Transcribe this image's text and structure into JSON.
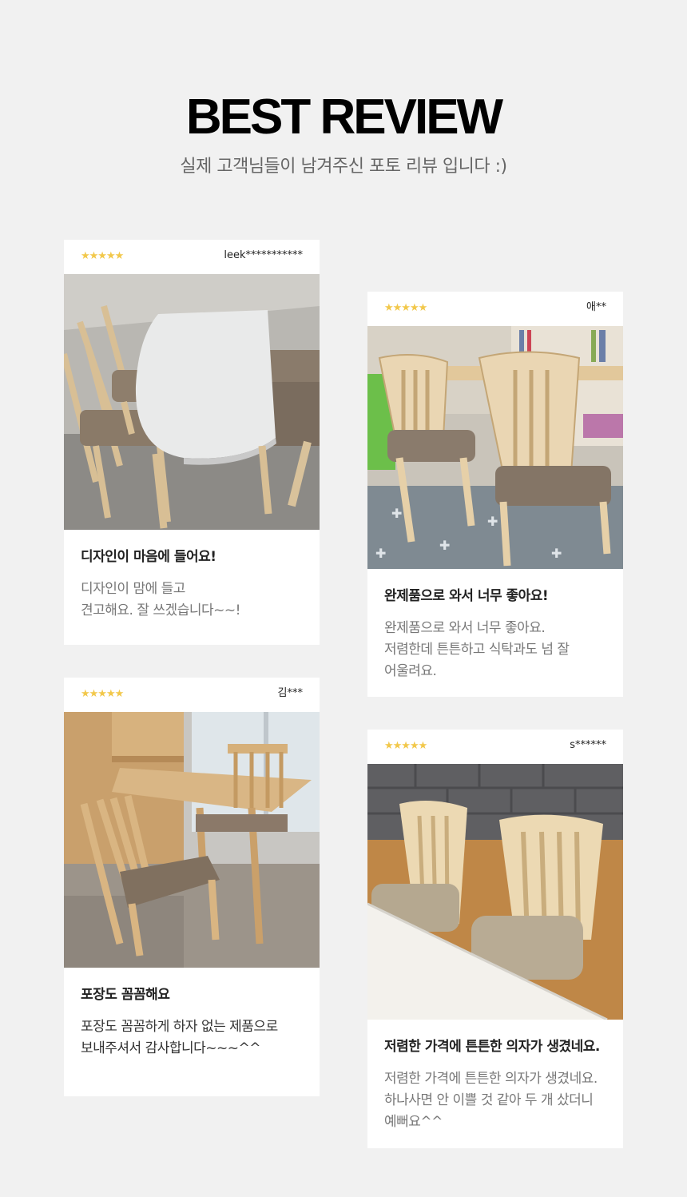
{
  "header": {
    "title": "BEST REVIEW",
    "subtitle": "실제 고객님들이 남겨주신 포토 리뷰 입니다 :)"
  },
  "reviews": [
    {
      "stars": "★★★★★",
      "user": "leek***********",
      "title": "디자인이 마음에 들어요!",
      "text": "디자인이 맘에 들고\n견고해요. 잘 쓰겠습니다~~!"
    },
    {
      "stars": "★★★★★",
      "user": "애**",
      "title": "완제품으로 와서 너무 좋아요!",
      "text": "완제품으로 와서 너무 좋아요.\n저렴한데 튼튼하고 식탁과도 넘 잘\n어울려요."
    },
    {
      "stars": "★★★★★",
      "user": "김***",
      "title": "포장도 꼼꼼해요",
      "text": "포장도 꼼꼼하게 하자 없는 제품으로\n보내주셔서 감사합니다~~~^^"
    },
    {
      "stars": "★★★★★",
      "user": "s******",
      "title": "저렴한 가격에 튼튼한 의자가 생겼네요.",
      "text": "저렴한 가격에 튼튼한 의자가 생겼네요.\n하나사면 안 이쁠 것 같아 두 개 샀더니\n예뻐요^^"
    }
  ],
  "colors": {
    "background": "#f1f1f1",
    "card": "#ffffff",
    "star": "#f2c84b"
  }
}
